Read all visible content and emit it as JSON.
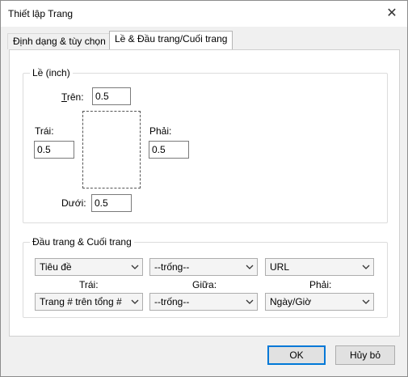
{
  "window": {
    "title": "Thiết lập Trang",
    "close_glyph": "✕"
  },
  "tabs": [
    {
      "label": "Định dạng & tùy chọn"
    },
    {
      "label": "Lề & Đầu trang/Cuối trang"
    }
  ],
  "margins": {
    "group_label": "Lề (inch)",
    "top_label": "Trên:",
    "top_value": "0.5",
    "left_label": "Trái:",
    "left_value": "0.5",
    "right_label": "Phải:",
    "right_value": "0.5",
    "bottom_label": "Dưới:",
    "bottom_value": "0.5"
  },
  "header_footer": {
    "group_label": "Đầu trang & Cuối trang",
    "header_left": "Tiêu đề",
    "header_center": "--trống--",
    "header_right": "URL",
    "col_left_label": "Trái:",
    "col_center_label": "Giữa:",
    "col_right_label": "Phải:",
    "footer_left": "Trang # trên tổng #",
    "footer_center": "--trống--",
    "footer_right": "Ngày/Giờ"
  },
  "buttons": {
    "ok": "OK",
    "cancel": "Hủy bỏ"
  }
}
